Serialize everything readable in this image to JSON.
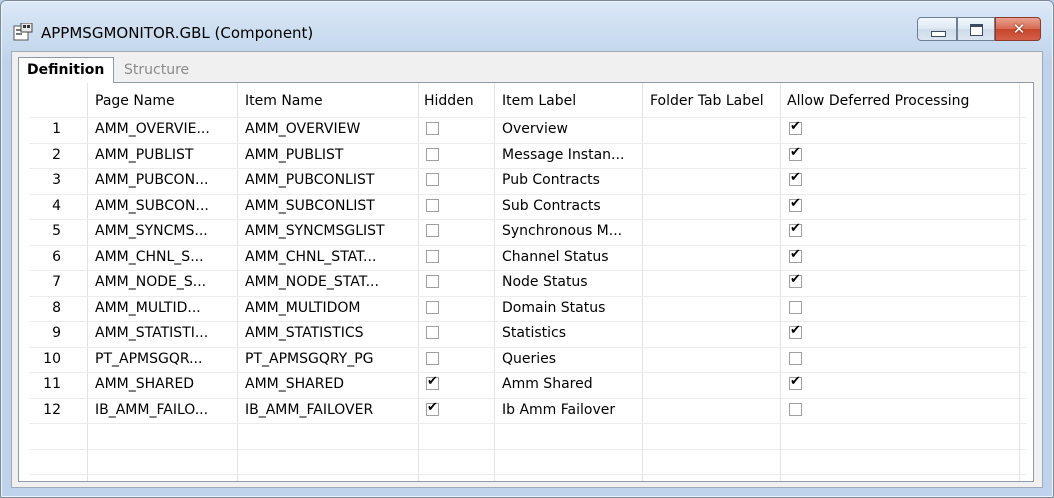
{
  "window": {
    "title": "APPMSGMONITOR.GBL (Component)"
  },
  "tabs": [
    {
      "label": "Definition",
      "active": true
    },
    {
      "label": "Structure",
      "active": false
    }
  ],
  "grid": {
    "columns": [
      "Page Name",
      "Item Name",
      "Hidden",
      "Item Label",
      "Folder Tab Label",
      "Allow Deferred Processing"
    ],
    "rows": [
      {
        "num": "1",
        "page": "AMM_OVERVIE...",
        "item": "AMM_OVERVIEW",
        "hidden": false,
        "label": "Overview",
        "folder": "",
        "deferred": true
      },
      {
        "num": "2",
        "page": "AMM_PUBLIST",
        "item": "AMM_PUBLIST",
        "hidden": false,
        "label": "Message Instan...",
        "folder": "",
        "deferred": true
      },
      {
        "num": "3",
        "page": "AMM_PUBCON...",
        "item": "AMM_PUBCONLIST",
        "hidden": false,
        "label": "Pub Contracts",
        "folder": "",
        "deferred": true
      },
      {
        "num": "4",
        "page": "AMM_SUBCON...",
        "item": "AMM_SUBCONLIST",
        "hidden": false,
        "label": "Sub Contracts",
        "folder": "",
        "deferred": true
      },
      {
        "num": "5",
        "page": "AMM_SYNCMS...",
        "item": "AMM_SYNCMSGLIST",
        "hidden": false,
        "label": "Synchronous M...",
        "folder": "",
        "deferred": true
      },
      {
        "num": "6",
        "page": "AMM_CHNL_S...",
        "item": "AMM_CHNL_STAT...",
        "hidden": false,
        "label": "Channel Status",
        "folder": "",
        "deferred": true
      },
      {
        "num": "7",
        "page": "AMM_NODE_S...",
        "item": "AMM_NODE_STAT...",
        "hidden": false,
        "label": "Node Status",
        "folder": "",
        "deferred": true
      },
      {
        "num": "8",
        "page": "AMM_MULTID...",
        "item": "AMM_MULTIDOM",
        "hidden": false,
        "label": "Domain Status",
        "folder": "",
        "deferred": false
      },
      {
        "num": "9",
        "page": "AMM_STATISTI...",
        "item": "AMM_STATISTICS",
        "hidden": false,
        "label": "Statistics",
        "folder": "",
        "deferred": true
      },
      {
        "num": "10",
        "page": "PT_APMSGQR...",
        "item": "PT_APMSGQRY_PG",
        "hidden": false,
        "label": "Queries",
        "folder": "",
        "deferred": false
      },
      {
        "num": "11",
        "page": "AMM_SHARED",
        "item": "AMM_SHARED",
        "hidden": true,
        "label": "Amm Shared",
        "folder": "",
        "deferred": true
      },
      {
        "num": "12",
        "page": "IB_AMM_FAILO...",
        "item": "IB_AMM_FAILOVER",
        "hidden": true,
        "label": "Ib Amm Failover",
        "folder": "",
        "deferred": false
      }
    ]
  }
}
